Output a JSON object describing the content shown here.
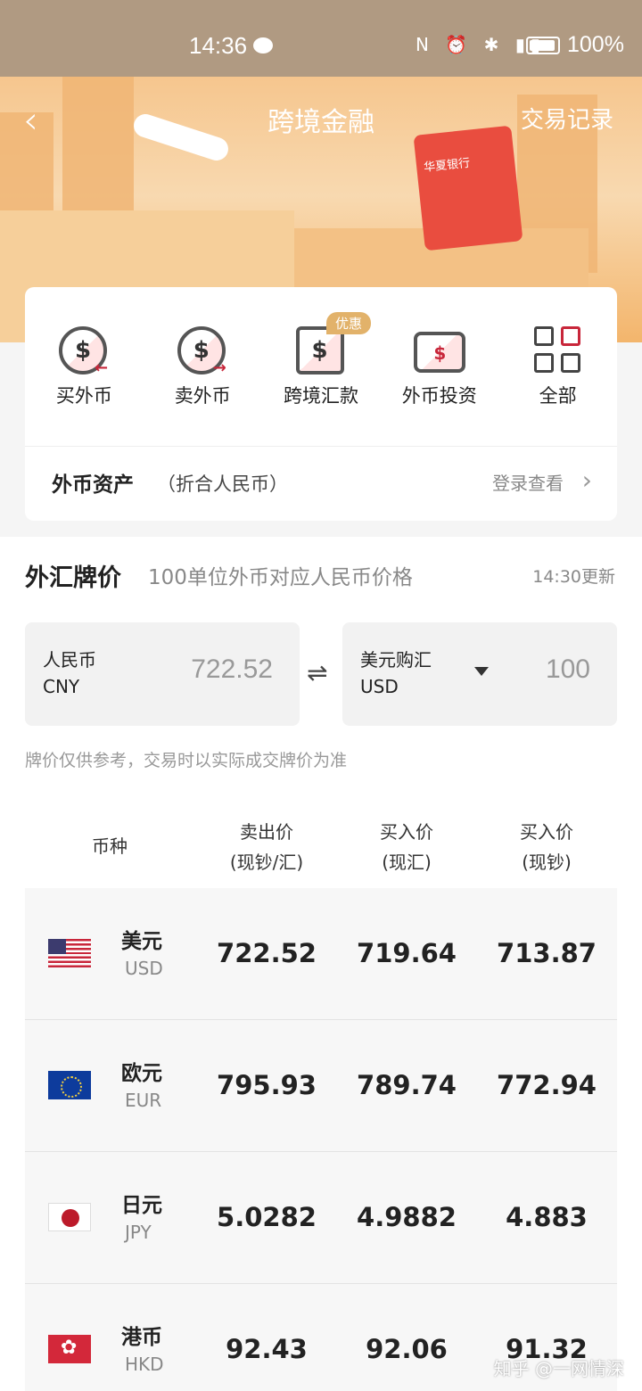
{
  "status_bar": {
    "time": "14:36",
    "battery": "100%"
  },
  "header": {
    "title": "跨境金融",
    "right_link": "交易记录",
    "banner_card_text": "华夏银行"
  },
  "menu": {
    "items": [
      {
        "label": "买外币",
        "icon": "buy-currency-icon"
      },
      {
        "label": "卖外币",
        "icon": "sell-currency-icon"
      },
      {
        "label": "跨境汇款",
        "icon": "remittance-icon",
        "badge": "优惠"
      },
      {
        "label": "外币投资",
        "icon": "wallet-icon"
      },
      {
        "label": "全部",
        "icon": "grid-icon"
      }
    ],
    "asset_title": "外币资产",
    "asset_sub": "（折合人民币）",
    "asset_login": "登录查看"
  },
  "rates": {
    "title": "外汇牌价",
    "subtitle": "100单位外币对应人民币价格",
    "update": "14:30更新",
    "converter": {
      "left": {
        "name": "人民币",
        "code": "CNY",
        "value": "722.52"
      },
      "right": {
        "name": "美元购汇",
        "code": "USD",
        "value": "100"
      }
    },
    "note": "牌价仅供参考，交易时以实际成交牌价为准",
    "headers": {
      "currency": "币种",
      "sell": [
        "卖出价",
        "(现钞/汇)"
      ],
      "buy_transfer": [
        "买入价",
        "(现汇)"
      ],
      "buy_cash": [
        "买入价",
        "(现钞)"
      ]
    },
    "rows": [
      {
        "name": "美元",
        "code": "USD",
        "flag": "us-flag-icon",
        "sell": "722.52",
        "buy_transfer": "719.64",
        "buy_cash": "713.87"
      },
      {
        "name": "欧元",
        "code": "EUR",
        "flag": "eu-flag-icon",
        "sell": "795.93",
        "buy_transfer": "789.74",
        "buy_cash": "772.94"
      },
      {
        "name": "日元",
        "code": "JPY",
        "flag": "jp-flag-icon",
        "sell": "5.0282",
        "buy_transfer": "4.9882",
        "buy_cash": "4.883"
      },
      {
        "name": "港币",
        "code": "HKD",
        "flag": "hk-flag-icon",
        "sell": "92.43",
        "buy_transfer": "92.06",
        "buy_cash": "91.32"
      }
    ]
  },
  "watermark": "知乎 @一网情深",
  "colors": {
    "accent_red": "#c8263a",
    "banner_orange": "#f6c68e",
    "badge_gold": "#e2b26a"
  }
}
